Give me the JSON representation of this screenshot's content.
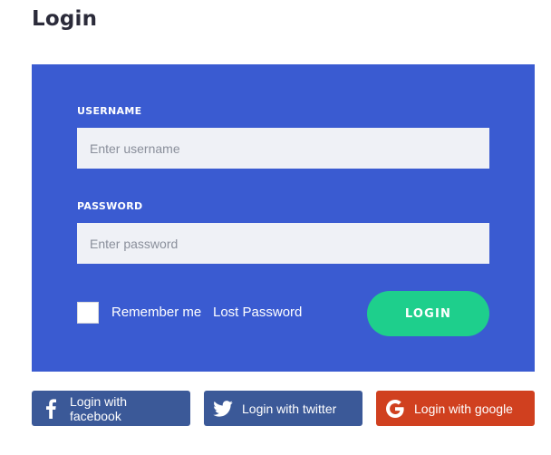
{
  "title": "Login",
  "form": {
    "username_label": "USERNAME",
    "username_placeholder": "Enter username",
    "password_label": "PASSWORD",
    "password_placeholder": "Enter password",
    "remember_label": "Remember me",
    "remember_checked": false,
    "lost_password_label": "Lost Password",
    "login_label": "LOGIN"
  },
  "social": {
    "facebook_label": "Login with facebook",
    "twitter_label": "Login with twitter",
    "google_label": "Login with google"
  },
  "colors": {
    "panel": "#3a5bd1",
    "login_button": "#1ecf8c",
    "facebook": "#3b5998",
    "twitter": "#3b5998",
    "google": "#d0401f"
  },
  "icons": {
    "facebook": "facebook-icon",
    "twitter": "twitter-icon",
    "google": "google-icon"
  }
}
